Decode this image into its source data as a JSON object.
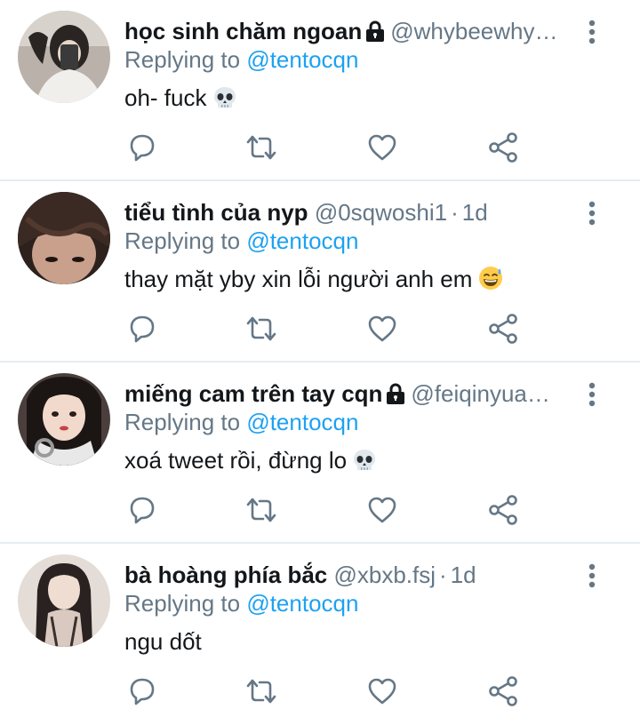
{
  "tweets": [
    {
      "display_name": "học sinh chăm ngoan",
      "protected": true,
      "handle": "@whybeewhy…",
      "time": "",
      "replying_label": "Replying to",
      "replying_handle": "@tentocqn",
      "text": "oh- fuck",
      "emoji": "skull-emoji"
    },
    {
      "display_name": "tiểu tình của nyp",
      "protected": false,
      "handle": "@0sqwoshi1",
      "time": "1d",
      "replying_label": "Replying to",
      "replying_handle": "@tentocqn",
      "text": "thay mặt yby xin lỗi người anh em",
      "emoji": "sweat-smile-emoji"
    },
    {
      "display_name": "miếng cam trên tay cqn",
      "protected": true,
      "handle": "@feiqinyua…",
      "time": "",
      "replying_label": "Replying to",
      "replying_handle": "@tentocqn",
      "text": "xoá tweet rồi, đừng lo",
      "emoji": "skull-emoji"
    },
    {
      "display_name": "bà hoàng phía bắc",
      "protected": false,
      "handle": "@xbxb.fsj",
      "time": "1d",
      "replying_label": "Replying to",
      "replying_handle": "@tentocqn",
      "text": "ngu dốt",
      "emoji": ""
    }
  ],
  "separator": "·",
  "colors": {
    "link": "#1da1f2",
    "secondary": "#657786",
    "text": "#14171a",
    "divider": "#e6ecf0"
  },
  "action_icons": [
    "reply-icon",
    "retweet-icon",
    "like-icon",
    "share-icon"
  ]
}
